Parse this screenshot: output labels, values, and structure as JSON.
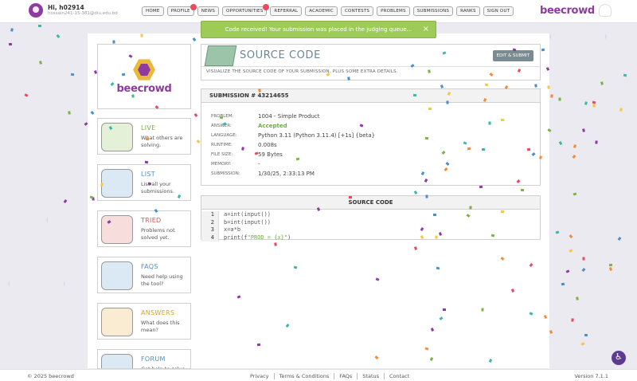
{
  "user": {
    "greeting": "Hi, h02914",
    "email": "hossain241-15-381@diu.edu.bd"
  },
  "nav": [
    {
      "label": "HOME",
      "notify": false
    },
    {
      "label": "PROFILE",
      "notify": true
    },
    {
      "label": "NEWS",
      "notify": false
    },
    {
      "label": "OPPORTUNITIES",
      "notify": true
    },
    {
      "label": "REFERRAL",
      "notify": false
    },
    {
      "label": "ACADEMIC",
      "notify": false
    },
    {
      "label": "CONTESTS",
      "notify": false
    },
    {
      "label": "PROBLEMS",
      "notify": false
    },
    {
      "label": "SUBMISSIONS",
      "notify": false
    },
    {
      "label": "RANKS",
      "notify": false
    },
    {
      "label": "SIGN OUT",
      "notify": false
    }
  ],
  "brand": "beecrowd",
  "toast": {
    "message": "Code received! Your submission was placed in the judging queue...",
    "close": "×"
  },
  "sidebar": {
    "logo_text": "beecrowd",
    "cards": [
      {
        "title": "LIVE",
        "desc": "What others are solving.",
        "color": "#7cb342",
        "icon": "globe-icon"
      },
      {
        "title": "LIST",
        "desc": "List all your submissions.",
        "color": "#4a90c8",
        "icon": "list-icon"
      },
      {
        "title": "TRIED",
        "desc": "Problems not solved yet.",
        "color": "#d9534f",
        "icon": "box-icon"
      },
      {
        "title": "FAQS",
        "desc": "Need help using the tool?",
        "color": "#4a90c8",
        "icon": "question-icon"
      },
      {
        "title": "ANSWERS",
        "desc": "What does this mean?",
        "color": "#e0a020",
        "icon": "lightbulb-icon"
      },
      {
        "title": "FORUM",
        "desc": "Get help to solve",
        "color": "#4a90c8",
        "icon": "forum-icon"
      }
    ]
  },
  "header": {
    "title": "SOURCE CODE",
    "edit_button": "EDIT & SUBMIT",
    "subtitle": "VISUALIZE THE SOURCE CODE OF YOUR SUBMISSION, PLUS SOME EXTRA DETAILS."
  },
  "submission": {
    "title": "SUBMISSION # 43214655",
    "rows": [
      {
        "label": "PROBLEM:",
        "value": "1004 - Simple Product"
      },
      {
        "label": "ANSWER:",
        "value": "Accepted"
      },
      {
        "label": "LANGUAGE:",
        "value": "Python 3.11 (Python 3.11.4) [+1s] {beta}"
      },
      {
        "label": "RUNTIME:",
        "value": "0.008s"
      },
      {
        "label": "FILE SIZE:",
        "value": "59 Bytes"
      },
      {
        "label": "MEMORY:",
        "value": "-"
      },
      {
        "label": "SUBMISSION:",
        "value": "1/30/25, 2:33:13 PM"
      }
    ]
  },
  "source_code": {
    "title": "SOURCE CODE",
    "lines": [
      {
        "n": "1",
        "code": "a=int(input())",
        "str": ""
      },
      {
        "n": "2",
        "code": "b=int(input())",
        "str": ""
      },
      {
        "n": "3",
        "code": "x=a*b",
        "str": ""
      },
      {
        "n": "4",
        "code": "print(f",
        "str": "\"PROD = {x}\"",
        "end": ")"
      }
    ]
  },
  "footer": {
    "copyright": "© 2025 beecrowd",
    "links": [
      "Privacy",
      "Terms & Conditions",
      "FAQs",
      "Status",
      "Contact"
    ],
    "version": "Version 7.1.1"
  },
  "colors": {
    "accent": "#8e3aa1",
    "toast": "#9ecb57",
    "accepted": "#6fae45"
  }
}
